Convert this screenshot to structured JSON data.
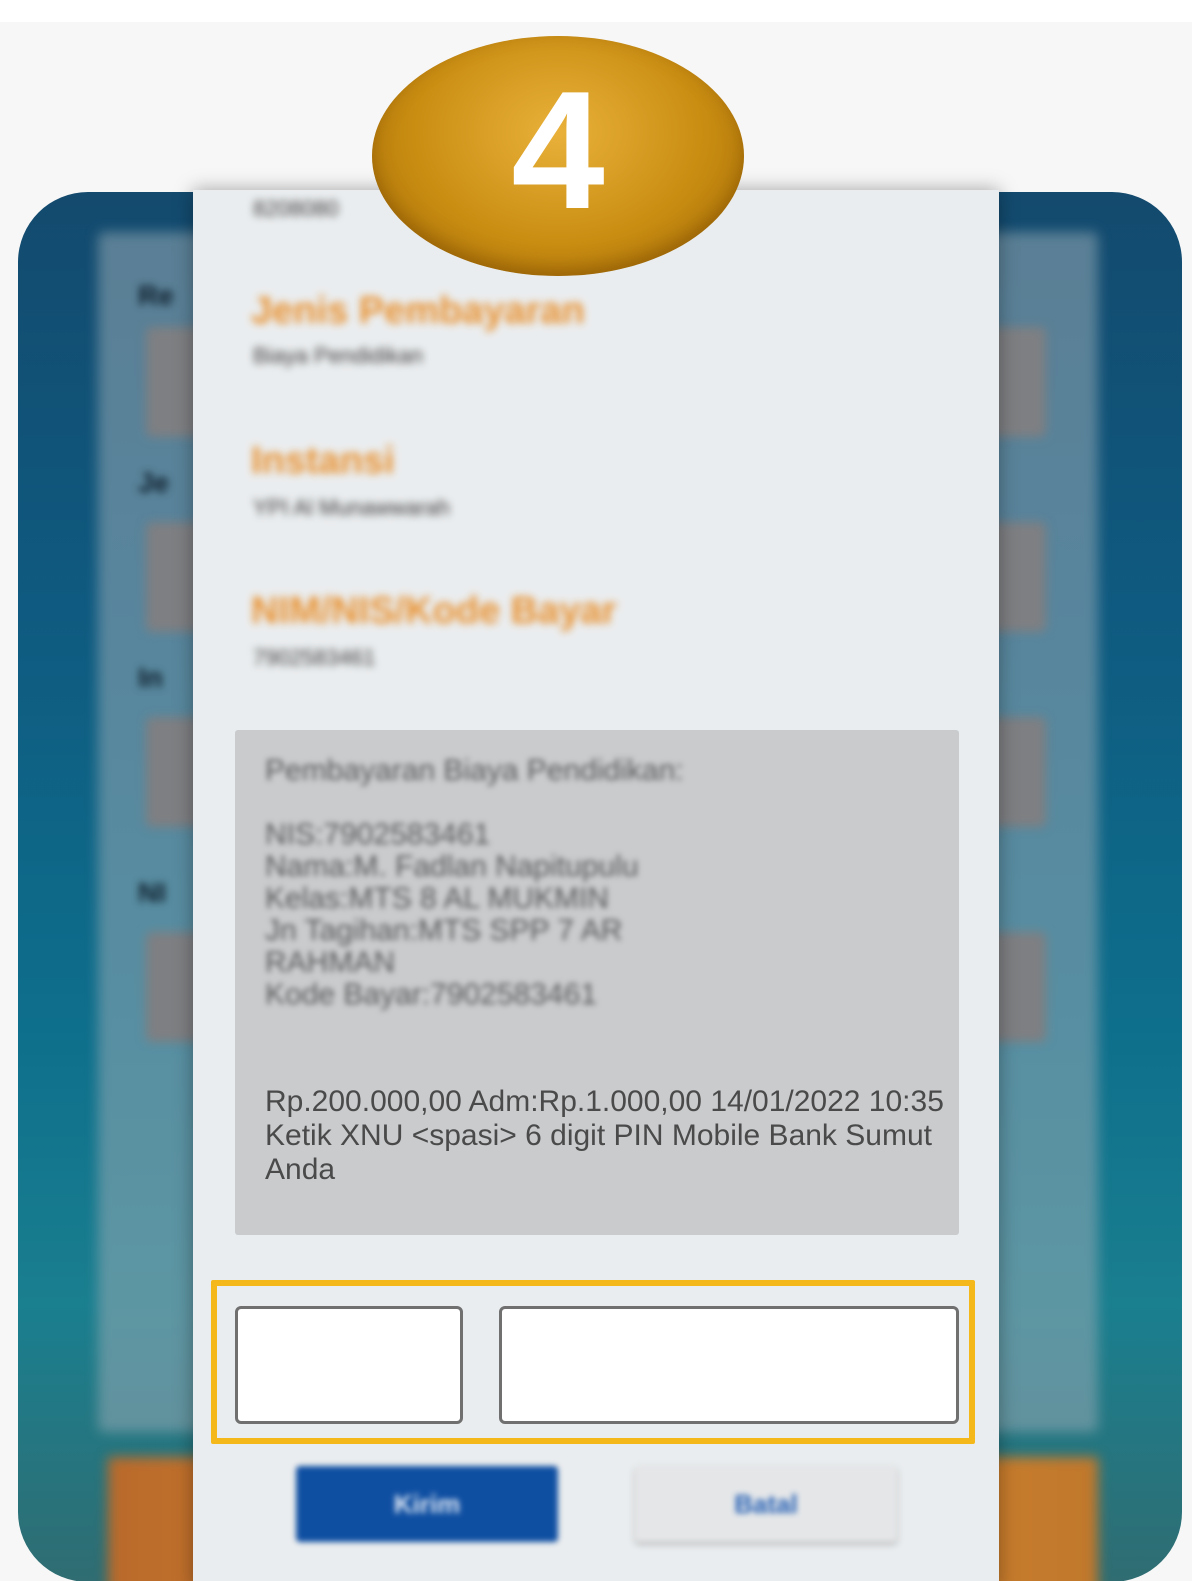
{
  "step": {
    "number": "4"
  },
  "background_form": {
    "labels": [
      "Re",
      "Je",
      "In",
      "NI"
    ]
  },
  "dialog": {
    "header_value": "8208080",
    "fields": [
      {
        "title": "Jenis Pembayaran",
        "value": "Biaya Pendidikan"
      },
      {
        "title": "Instansi",
        "value": "YPI Al Munawwarah"
      },
      {
        "title": "NIM/NIS/Kode Bayar",
        "value": "7902583461"
      }
    ],
    "message": {
      "intro": "Pembayaran Biaya Pendidikan:",
      "details": [
        "NIS:7902583461",
        "Nama:M. Fadlan Napitupulu",
        "Kelas:MTS  8 AL MUKMIN",
        "Jn Tagihan:MTS SPP 7 AR",
        "RAHMAN",
        "Kode Bayar:7902583461"
      ],
      "instruction": "Rp.200.000,00 Adm:Rp.1.000,00 14/01/2022 10:35 Ketik XNU <spasi> 6 digit PIN Mobile Bank Sumut Anda"
    },
    "inputs": {
      "keyword_value": "",
      "pin_value": ""
    },
    "buttons": {
      "send": "Kirim",
      "cancel": "Batal"
    }
  },
  "colors": {
    "accent_orange": "#e8902e",
    "highlight_yellow": "#f5b81b",
    "send_blue": "#0f4fa2",
    "badge_gold": "#c98d12"
  }
}
